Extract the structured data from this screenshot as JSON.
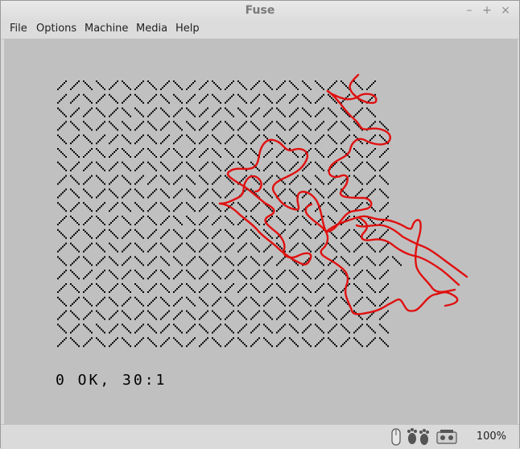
{
  "window": {
    "title": "Fuse"
  },
  "window_controls": {
    "minimize": "–",
    "maximize": "+",
    "close": "×"
  },
  "menu": [
    "File",
    "Options",
    "Machine",
    "Media",
    "Help"
  ],
  "screen": {
    "status_text": "0 OK, 30:1",
    "pattern_rows": [
      "//\\\\/\\/\\/\\//\\/\\/\\/\\\\\\/\\\\/",
      "//\\/\\/\\/\\\\//\\/\\/\\//\\/\\/\\/",
      "\\//\\/\\\\/\\/\\//\\\\//\\/\\/\\\\/\\",
      "/\\\\/\\\\/\\/\\\\//\\/\\/\\/\\//\\\\/\\",
      "\\/\\//\\/\\//\\/\\/\\/\\\\/\\/\\/\\/\\",
      "\\\\/\\/\\/\\/\\//\\\\/\\//\\/\\/\\\\//",
      "\\//\\/\\/\\\\/\\/\\/\\\\/\\//\\/\\/\\/",
      "/\\/\\/\\//\\/\\\\/\\/\\/\\/\\\\//\\/\\",
      "/\\\\/\\/\\/\\/\\/\\//\\\\/\\/\\/\\//\\",
      "\\/\\//\\\\/\\/\\/\\/\\/\\/\\//\\\\/\\/",
      "/\\/\\/\\/\\/\\\\//\\/\\/\\/\\/\\/\\\\/",
      "\\/\\/\\/\\//\\/\\/\\/\\\\//\\/\\/\\//",
      "/\\/\\\\/\\/\\/\\/\\//\\/\\/\\/\\\\/\\/",
      "\\/\\/\\/\\/\\\\/\\/\\/\\//\\/\\/\\/\\/\\",
      "/\\//\\/\\/\\/\\/\\/\\/\\/\\\\//\\/\\/",
      "/\\/\\/\\\\/\\/\\/\\//\\/\\/\\/\\/\\\\/",
      "\\/\\/\\/\\/\\/\\\\/\\/\\/\\/\\//\\/\\/",
      "/\\/\\/\\/\\//\\/\\/\\/\\/\\/\\\\/\\//",
      "\\/\\\\/\\/\\/\\/\\/\\//\\/\\/\\/\\/\\\\",
      "/\\/\\/\\/\\/\\//\\/\\/\\/\\\\/\\/\\/\\"
    ],
    "colors": {
      "paper": "#c0c0c0",
      "ink": "#000000",
      "annotation": "#e01010"
    }
  },
  "statusbar": {
    "icons": [
      "mouse-icon",
      "footprints-icon",
      "tape-icon"
    ],
    "zoom": "100%"
  }
}
